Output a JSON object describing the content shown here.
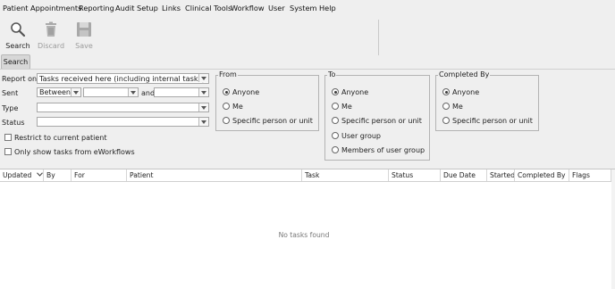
{
  "menubar": {
    "items": [
      "Patient",
      "Appointments",
      "Reporting",
      "Audit",
      "Setup",
      "Links",
      "Clinical Tools",
      "Workflow",
      "User",
      "System",
      "Help"
    ]
  },
  "toolbar": {
    "search_label": "Search",
    "discard_label": "Discard",
    "save_label": "Save"
  },
  "tab": {
    "label": "Search"
  },
  "form": {
    "report_on_label": "Report on",
    "report_on_value": "Tasks received here (including internal tasks)",
    "sent_label": "Sent",
    "sent_mode": "Between",
    "sent_from": "",
    "and_label": "and",
    "sent_to": "",
    "type_label": "Type",
    "type_value": "",
    "status_label": "Status",
    "status_value": "",
    "restrict_label": "Restrict to current patient",
    "eworkflows_label": "Only show tasks from eWorkflows"
  },
  "from_group": {
    "title": "From",
    "options": [
      "Anyone",
      "Me",
      "Specific person or unit"
    ],
    "selected": 0
  },
  "to_group": {
    "title": "To",
    "options": [
      "Anyone",
      "Me",
      "Specific person or unit",
      "User group",
      "Members of user group"
    ],
    "selected": 0
  },
  "completed_group": {
    "title": "Completed By",
    "options": [
      "Anyone",
      "Me",
      "Specific person or unit"
    ],
    "selected": 0
  },
  "table": {
    "columns": [
      "Updated",
      "By",
      "For",
      "Patient",
      "Task",
      "Status",
      "Due Date",
      "Started",
      "Completed By",
      "Flags"
    ],
    "sort_column": "Updated",
    "empty_message": "No tasks found"
  },
  "icons": {
    "search": "magnifier-icon",
    "discard": "trash-icon",
    "save": "floppy-icon",
    "sort": "chevron-down-icon"
  }
}
